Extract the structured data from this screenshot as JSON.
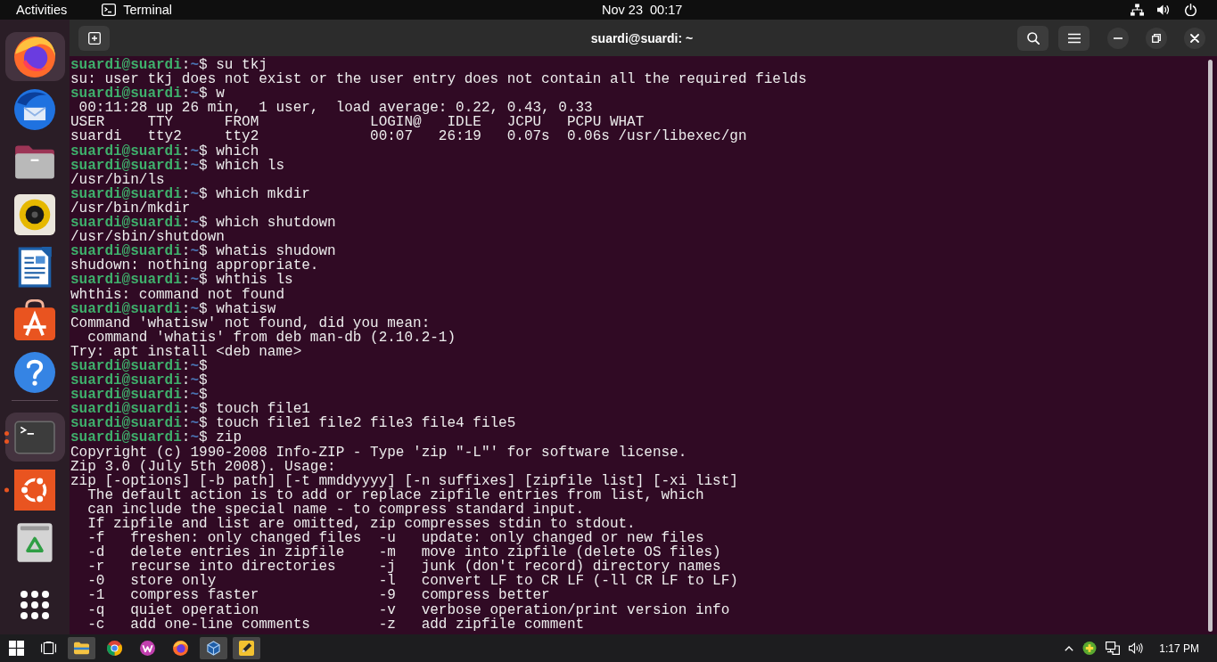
{
  "top_bar": {
    "activities": "Activities",
    "app_menu": "Terminal",
    "clock": "Nov 23  00:17"
  },
  "dock": {
    "favorites": [
      {
        "kind": "fox",
        "highlighted": true,
        "running": false
      },
      {
        "kind": "bird",
        "highlighted": false,
        "running": false
      },
      {
        "kind": "folder",
        "highlighted": false,
        "running": false
      },
      {
        "kind": "speaker",
        "highlighted": false,
        "running": false
      },
      {
        "kind": "document",
        "highlighted": false,
        "running": false
      },
      {
        "kind": "bag",
        "highlighted": false,
        "running": false
      },
      {
        "kind": "help",
        "highlighted": false,
        "running": false
      }
    ],
    "running": [
      {
        "kind": "terminal",
        "highlighted": true,
        "running": true,
        "several_windows": true
      },
      {
        "kind": "friends",
        "highlighted": false,
        "running": true,
        "several_windows": false
      },
      {
        "kind": "trash",
        "highlighted": false,
        "running": false
      }
    ]
  },
  "terminal": {
    "title": "suardi@suardi: ~",
    "lines": [
      {
        "kind": "prompt",
        "user_host": "suardi@suardi",
        "separator": ":",
        "path": "~",
        "symbol": "$",
        "command": "su tkj"
      },
      {
        "kind": "output",
        "text": "su: user tkj does not exist or the user entry does not contain all the required fields"
      },
      {
        "kind": "prompt",
        "user_host": "suardi@suardi",
        "separator": ":",
        "path": "~",
        "symbol": "$",
        "command": "w"
      },
      {
        "kind": "output",
        "text": " 00:11:28 up 26 min,  1 user,  load average: 0.22, 0.43, 0.33"
      },
      {
        "kind": "output",
        "text": "USER     TTY      FROM             LOGIN@   IDLE   JCPU   PCPU WHAT"
      },
      {
        "kind": "output",
        "text": "suardi   tty2     tty2             00:07   26:19   0.07s  0.06s /usr/libexec/gn"
      },
      {
        "kind": "prompt",
        "user_host": "suardi@suardi",
        "separator": ":",
        "path": "~",
        "symbol": "$",
        "command": "which"
      },
      {
        "kind": "prompt",
        "user_host": "suardi@suardi",
        "separator": ":",
        "path": "~",
        "symbol": "$",
        "command": "which ls"
      },
      {
        "kind": "output",
        "text": "/usr/bin/ls"
      },
      {
        "kind": "prompt",
        "user_host": "suardi@suardi",
        "separator": ":",
        "path": "~",
        "symbol": "$",
        "command": "which mkdir"
      },
      {
        "kind": "output",
        "text": "/usr/bin/mkdir"
      },
      {
        "kind": "prompt",
        "user_host": "suardi@suardi",
        "separator": ":",
        "path": "~",
        "symbol": "$",
        "command": "which shutdown"
      },
      {
        "kind": "output",
        "text": "/usr/sbin/shutdown"
      },
      {
        "kind": "prompt",
        "user_host": "suardi@suardi",
        "separator": ":",
        "path": "~",
        "symbol": "$",
        "command": "whatis shudown"
      },
      {
        "kind": "output",
        "text": "shudown: nothing appropriate."
      },
      {
        "kind": "prompt",
        "user_host": "suardi@suardi",
        "separator": ":",
        "path": "~",
        "symbol": "$",
        "command": "whthis ls"
      },
      {
        "kind": "output",
        "text": "whthis: command not found"
      },
      {
        "kind": "prompt",
        "user_host": "suardi@suardi",
        "separator": ":",
        "path": "~",
        "symbol": "$",
        "command": "whatisw"
      },
      {
        "kind": "output",
        "text": "Command 'whatisw' not found, did you mean:"
      },
      {
        "kind": "output",
        "text": "  command 'whatis' from deb man-db (2.10.2-1)"
      },
      {
        "kind": "output",
        "text": "Try: apt install <deb name>"
      },
      {
        "kind": "prompt",
        "user_host": "suardi@suardi",
        "separator": ":",
        "path": "~",
        "symbol": "$"
      },
      {
        "kind": "prompt",
        "user_host": "suardi@suardi",
        "separator": ":",
        "path": "~",
        "symbol": "$"
      },
      {
        "kind": "prompt",
        "user_host": "suardi@suardi",
        "separator": ":",
        "path": "~",
        "symbol": "$"
      },
      {
        "kind": "prompt",
        "user_host": "suardi@suardi",
        "separator": ":",
        "path": "~",
        "symbol": "$",
        "command": "touch file1"
      },
      {
        "kind": "prompt",
        "user_host": "suardi@suardi",
        "separator": ":",
        "path": "~",
        "symbol": "$",
        "command": "touch file1 file2 file3 file4 file5"
      },
      {
        "kind": "prompt",
        "user_host": "suardi@suardi",
        "separator": ":",
        "path": "~",
        "symbol": "$",
        "command": "zip"
      },
      {
        "kind": "output",
        "text": "Copyright (c) 1990-2008 Info-ZIP - Type 'zip \"-L\"' for software license."
      },
      {
        "kind": "output",
        "text": "Zip 3.0 (July 5th 2008). Usage:"
      },
      {
        "kind": "output",
        "text": "zip [-options] [-b path] [-t mmddyyyy] [-n suffixes] [zipfile list] [-xi list]"
      },
      {
        "kind": "output",
        "text": "  The default action is to add or replace zipfile entries from list, which"
      },
      {
        "kind": "output",
        "text": "  can include the special name - to compress standard input."
      },
      {
        "kind": "output",
        "text": "  If zipfile and list are omitted, zip compresses stdin to stdout."
      },
      {
        "kind": "output",
        "text": "  -f   freshen: only changed files  -u   update: only changed or new files"
      },
      {
        "kind": "output",
        "text": "  -d   delete entries in zipfile    -m   move into zipfile (delete OS files)"
      },
      {
        "kind": "output",
        "text": "  -r   recurse into directories     -j   junk (don't record) directory names"
      },
      {
        "kind": "output",
        "text": "  -0   store only                   -l   convert LF to CR LF (-ll CR LF to LF)"
      },
      {
        "kind": "output",
        "text": "  -1   compress faster              -9   compress better"
      },
      {
        "kind": "output",
        "text": "  -q   quiet operation              -v   verbose operation/print version info"
      },
      {
        "kind": "output",
        "text": "  -c   add one-line comments        -z   add zipfile comment"
      }
    ]
  },
  "taskbar": {
    "apps": [
      {
        "kind": "folder",
        "highlighted": true
      },
      {
        "kind": "ring",
        "highlighted": false
      },
      {
        "kind": "badge",
        "highlighted": false
      },
      {
        "kind": "fox",
        "highlighted": false
      },
      {
        "kind": "cube",
        "highlighted": true
      },
      {
        "kind": "pencil",
        "highlighted": true
      }
    ],
    "clock": "1:17 PM"
  }
}
